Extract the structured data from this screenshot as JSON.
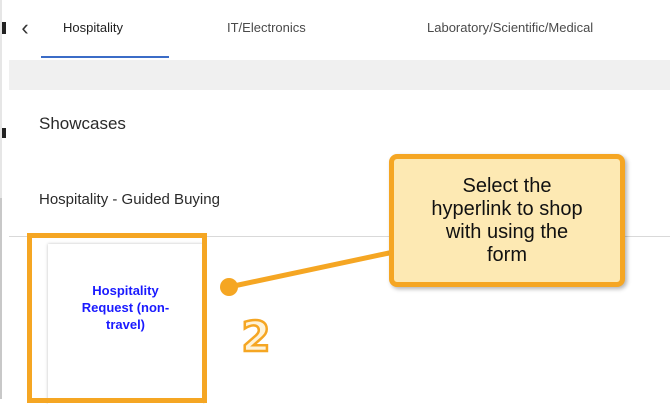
{
  "tabs": [
    {
      "label": "Hospitality",
      "active": true
    },
    {
      "label": "IT/Electronics",
      "active": false
    },
    {
      "label": "Laboratory/Scientific/Medical",
      "active": false
    }
  ],
  "back_icon": "chevron-left-icon",
  "section_title": "Showcases",
  "showcase_group": "Hospitality - Guided Buying",
  "card": {
    "link_line1": "Hospitality",
    "link_line2": "Request (non-",
    "link_line3": "travel)"
  },
  "annotation": {
    "step_number": "2",
    "callout_line1": "Select the",
    "callout_line2": "hyperlink to shop",
    "callout_line3": "with using the",
    "callout_line4": "form"
  },
  "colors": {
    "accent_orange": "#f5a623",
    "callout_fill": "#fde9b3",
    "link_blue": "#1a1aff",
    "tab_underline": "#3b6cc7"
  }
}
